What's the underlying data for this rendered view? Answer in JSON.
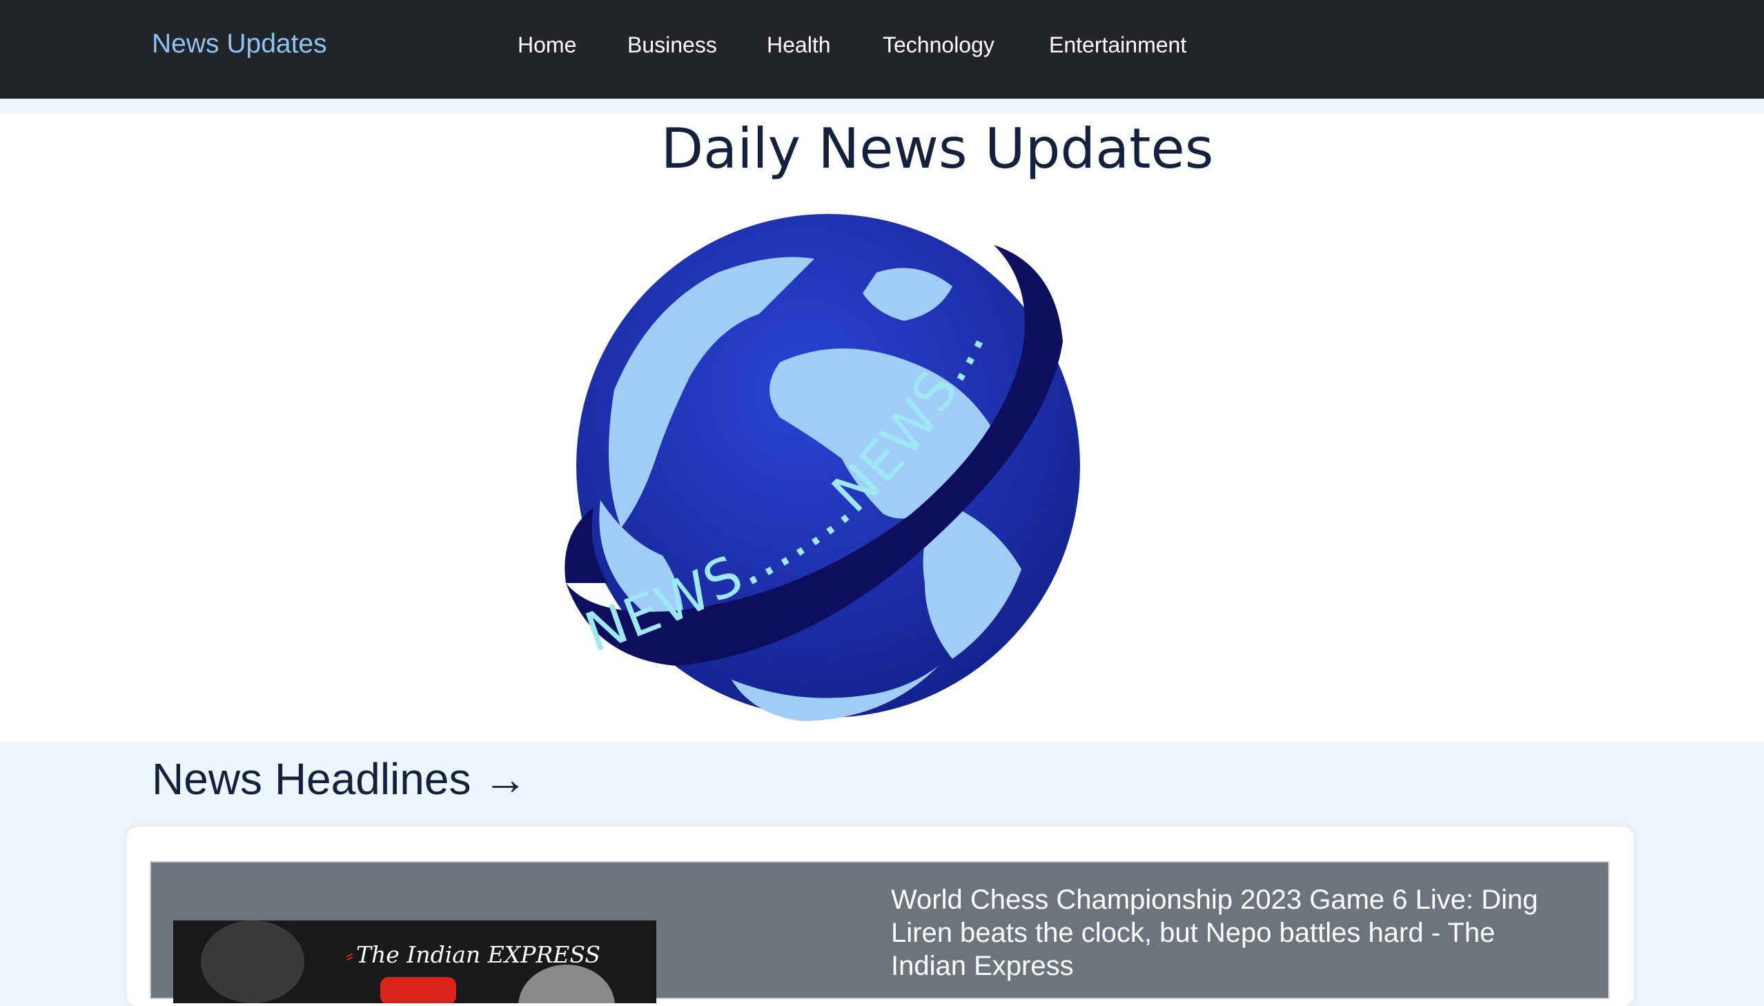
{
  "navbar": {
    "brand": "News Updates",
    "links": [
      "Home",
      "Business",
      "Health",
      "Technology",
      "Entertainment"
    ]
  },
  "hero": {
    "title": "Daily News Updates",
    "logo_text": "NEWS.......NEWS......"
  },
  "headlines": {
    "section_title": "News Headlines →",
    "items": [
      {
        "title": "World Chess Championship 2023 Game 6 Live: Ding Liren beats the clock, but Nepo battles hard - The Indian Express",
        "image_source": "The Indian EXPRESS"
      }
    ]
  },
  "colors": {
    "navbar_bg": "#212529",
    "brand": "#8fc3f4",
    "page_bg": "#eef6fd",
    "card_item_bg": "#6c757d",
    "globe_ocean": "#2237b8",
    "globe_land": "#9fcdf8",
    "ribbon": "#0d0f5e"
  }
}
